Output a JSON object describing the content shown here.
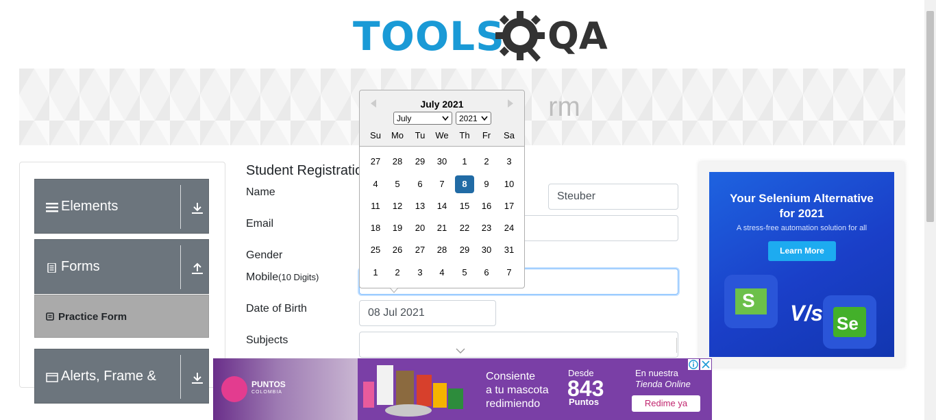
{
  "header": {
    "logo_text": "TOOLS",
    "logo_alt": "QA"
  },
  "banner": {
    "title": "rm"
  },
  "sidebar": {
    "groups": [
      {
        "label": "Elements",
        "icon": "hamburger-icon",
        "arrow": "download-arrow-icon"
      },
      {
        "label": "Forms",
        "icon": "document-icon",
        "arrow": "upload-arrow-icon"
      },
      {
        "label": "Alerts, Frame &",
        "icon": "window-icon",
        "arrow": "download-arrow-icon"
      }
    ],
    "active_item": {
      "label": "Practice Form",
      "icon": "form-icon"
    }
  },
  "form": {
    "title": "Student Registratio",
    "labels": {
      "name": "Name",
      "email": "Email",
      "gender": "Gender",
      "mobile": "Mobile",
      "mobile_hint": "(10 Digits)",
      "dob": "Date of Birth",
      "subjects": "Subjects"
    },
    "last_name_value": "Steuber",
    "dob_value": "08 Jul 2021"
  },
  "datepicker": {
    "title": "July 2021",
    "month_select": "July",
    "year_select": "2021",
    "weekdays": [
      "Su",
      "Mo",
      "Tu",
      "We",
      "Th",
      "Fr",
      "Sa"
    ],
    "weeks": [
      [
        "27",
        "28",
        "29",
        "30",
        "1",
        "2",
        "3"
      ],
      [
        "4",
        "5",
        "6",
        "7",
        "8",
        "9",
        "10"
      ],
      [
        "11",
        "12",
        "13",
        "14",
        "15",
        "16",
        "17"
      ],
      [
        "18",
        "19",
        "20",
        "21",
        "22",
        "23",
        "24"
      ],
      [
        "25",
        "26",
        "27",
        "28",
        "29",
        "30",
        "31"
      ],
      [
        "1",
        "2",
        "3",
        "4",
        "5",
        "6",
        "7"
      ]
    ],
    "selected_day": "8"
  },
  "ad_right": {
    "headline": "Your Selenium Alternative for 2021",
    "sub": "A stress-free automation solution for all",
    "cta": "Learn More",
    "vs": "V/s",
    "left_badge": "S",
    "right_badge": "Se"
  },
  "ad_bottom": {
    "brand": "PUNTOS",
    "brand_sub": "COLOMBIA",
    "line1": "Consiente",
    "line2": "a tu mascota",
    "line3": "redimiendo",
    "desde": "Desde",
    "points": "843",
    "points_label": "Puntos",
    "tienda1": "En nuestra",
    "tienda2": "Tienda Online",
    "cta": "Redime ya"
  },
  "colors": {
    "accent": "#1a9ad6",
    "sidebar_header": "#6c757d",
    "selected_day": "#216ba5"
  }
}
